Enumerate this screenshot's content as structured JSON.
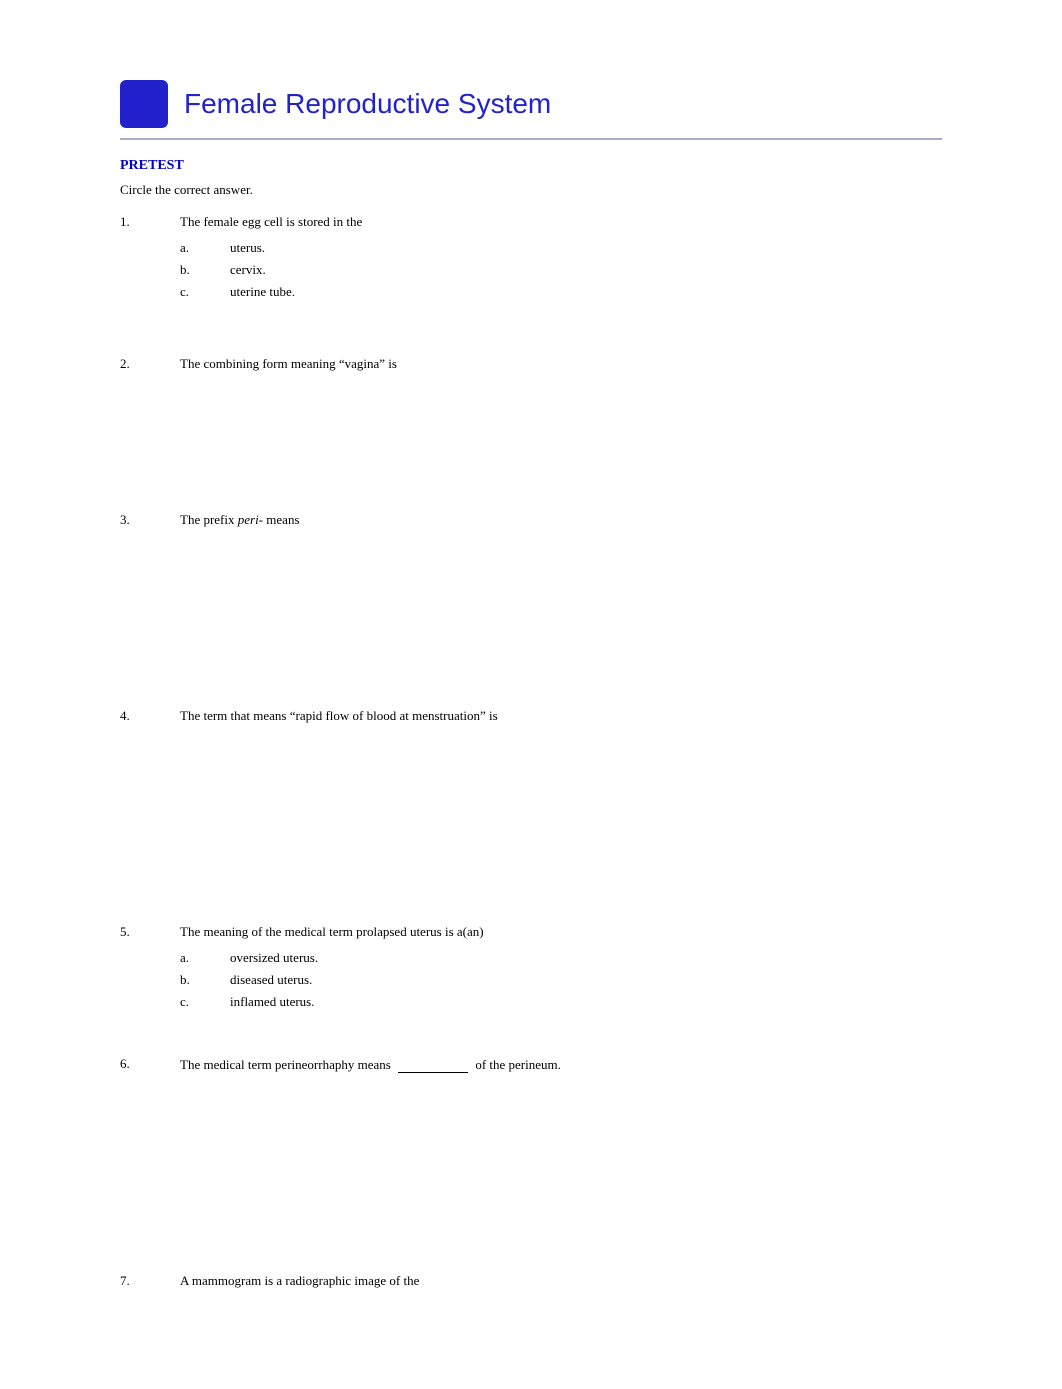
{
  "header": {
    "title": "Female Reproductive System",
    "icon_label": "header-icon"
  },
  "section": {
    "label": "PRETEST",
    "instruction": "Circle the correct answer."
  },
  "questions": [
    {
      "number": "1.",
      "text": "The female egg cell is stored in the",
      "type": "multiple_choice",
      "options": [
        {
          "label": "a.",
          "text": "uterus."
        },
        {
          "label": "b.",
          "text": "cervix."
        },
        {
          "label": "c.",
          "text": "uterine tube."
        }
      ]
    },
    {
      "number": "2.",
      "text": "The combining form meaning “vagina” is",
      "type": "open",
      "options": []
    },
    {
      "number": "3.",
      "text_parts": [
        "The prefix ",
        "peri-",
        " means"
      ],
      "type": "open",
      "options": []
    },
    {
      "number": "4.",
      "text": "The term that means “rapid flow of blood at menstruation” is",
      "type": "open",
      "options": []
    },
    {
      "number": "5.",
      "text": "The meaning of the medical term prolapsed uterus  is a(an)",
      "type": "multiple_choice",
      "options": [
        {
          "label": "a.",
          "text": "oversized uterus."
        },
        {
          "label": "b.",
          "text": "diseased uterus."
        },
        {
          "label": "c.",
          "text": "inflamed uterus."
        }
      ]
    },
    {
      "number": "6.",
      "text_parts": [
        "The medical term perineorrhaphy  means ",
        "BLANK",
        " of the perineum."
      ],
      "type": "fill_blank",
      "options": []
    },
    {
      "number": "7.",
      "text": "A mammogram is a radiographic image of the",
      "type": "open",
      "options": []
    }
  ]
}
